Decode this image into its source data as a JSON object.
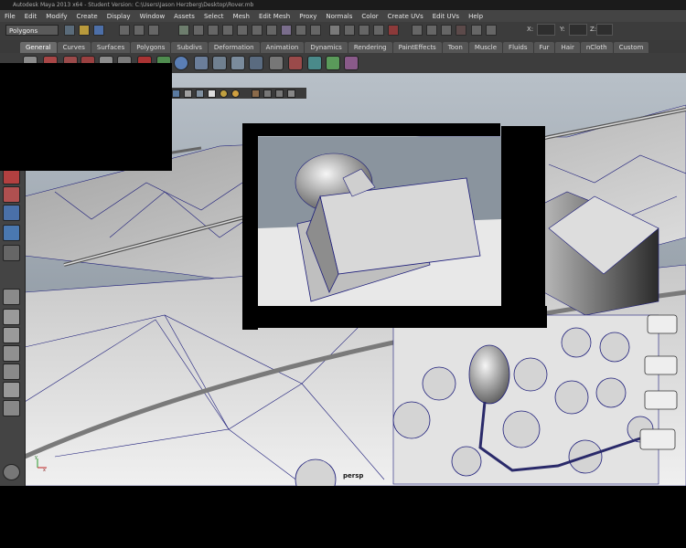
{
  "titlebar": {
    "text": "Autodesk Maya 2013 x64 - Student Version: C:\\Users\\Jason Herzberg\\Desktop\\Rover.mb"
  },
  "menubar": {
    "items": [
      "File",
      "Edit",
      "Modify",
      "Create",
      "Display",
      "Window",
      "Assets",
      "Select",
      "Mesh",
      "Edit Mesh",
      "Proxy",
      "Normals",
      "Color",
      "Create UVs",
      "Edit UVs",
      "Help"
    ]
  },
  "status_line": {
    "mode": "Polygons",
    "coords": [
      {
        "label": "X:"
      },
      {
        "label": "Y:"
      },
      {
        "label": "Z:"
      }
    ]
  },
  "shelf": {
    "tabs": [
      "General",
      "Curves",
      "Surfaces",
      "Polygons",
      "Subdivs",
      "Deformation",
      "Animation",
      "Dynamics",
      "Rendering",
      "PaintEffects",
      "Toon",
      "Muscle",
      "Fluids",
      "Fur",
      "Hair",
      "nCloth",
      "Custom"
    ],
    "active_tab": "General"
  },
  "viewport": {
    "camera_label": "persp",
    "axis_labels": {
      "y": "y",
      "x": "x"
    }
  },
  "colors": {
    "menubar": "#444444",
    "wire": "#1c1c7a",
    "viewport_bg": "#9aa4ae"
  }
}
